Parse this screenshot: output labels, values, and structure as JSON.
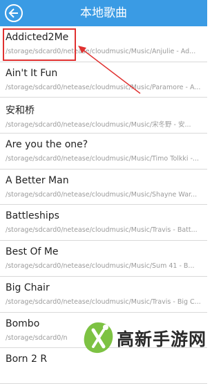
{
  "header": {
    "title": "本地歌曲"
  },
  "songs": [
    {
      "title": "Addicted2Me",
      "path": "/storage/sdcard0/netease/cloudmusic/Music/Anjulie - Ad..."
    },
    {
      "title": "Ain't It Fun",
      "path": "/storage/sdcard0/netease/cloudmusic/Music/Paramore - A..."
    },
    {
      "title": "安和桥",
      "path": "/storage/sdcard0/netease/cloudmusic/Music/宋冬野 - 安..."
    },
    {
      "title": "Are you the one?",
      "path": "/storage/sdcard0/netease/cloudmusic/Music/Timo Tolkki -..."
    },
    {
      "title": "A Better Man",
      "path": "/storage/sdcard0/netease/cloudmusic/Music/Shayne War..."
    },
    {
      "title": "Battleships",
      "path": "/storage/sdcard0/netease/cloudmusic/Music/Travis - Batt..."
    },
    {
      "title": "Best Of Me",
      "path": "/storage/sdcard0/netease/cloudmusic/Music/Sum 41 - B..."
    },
    {
      "title": "Big Chair",
      "path": "/storage/sdcard0/netease/cloudmusic/Music/Travis - Big C..."
    },
    {
      "title": "Bombo",
      "path": "/storage/sdcard0/n"
    },
    {
      "title": "Born 2 R",
      "path": ""
    }
  ],
  "watermark": {
    "text": "高新手游网"
  },
  "colors": {
    "header": "#3a9be4",
    "highlight": "#e0302f",
    "logo_green": "#7dc243"
  },
  "icons": {
    "back": "back-arrow-icon"
  }
}
